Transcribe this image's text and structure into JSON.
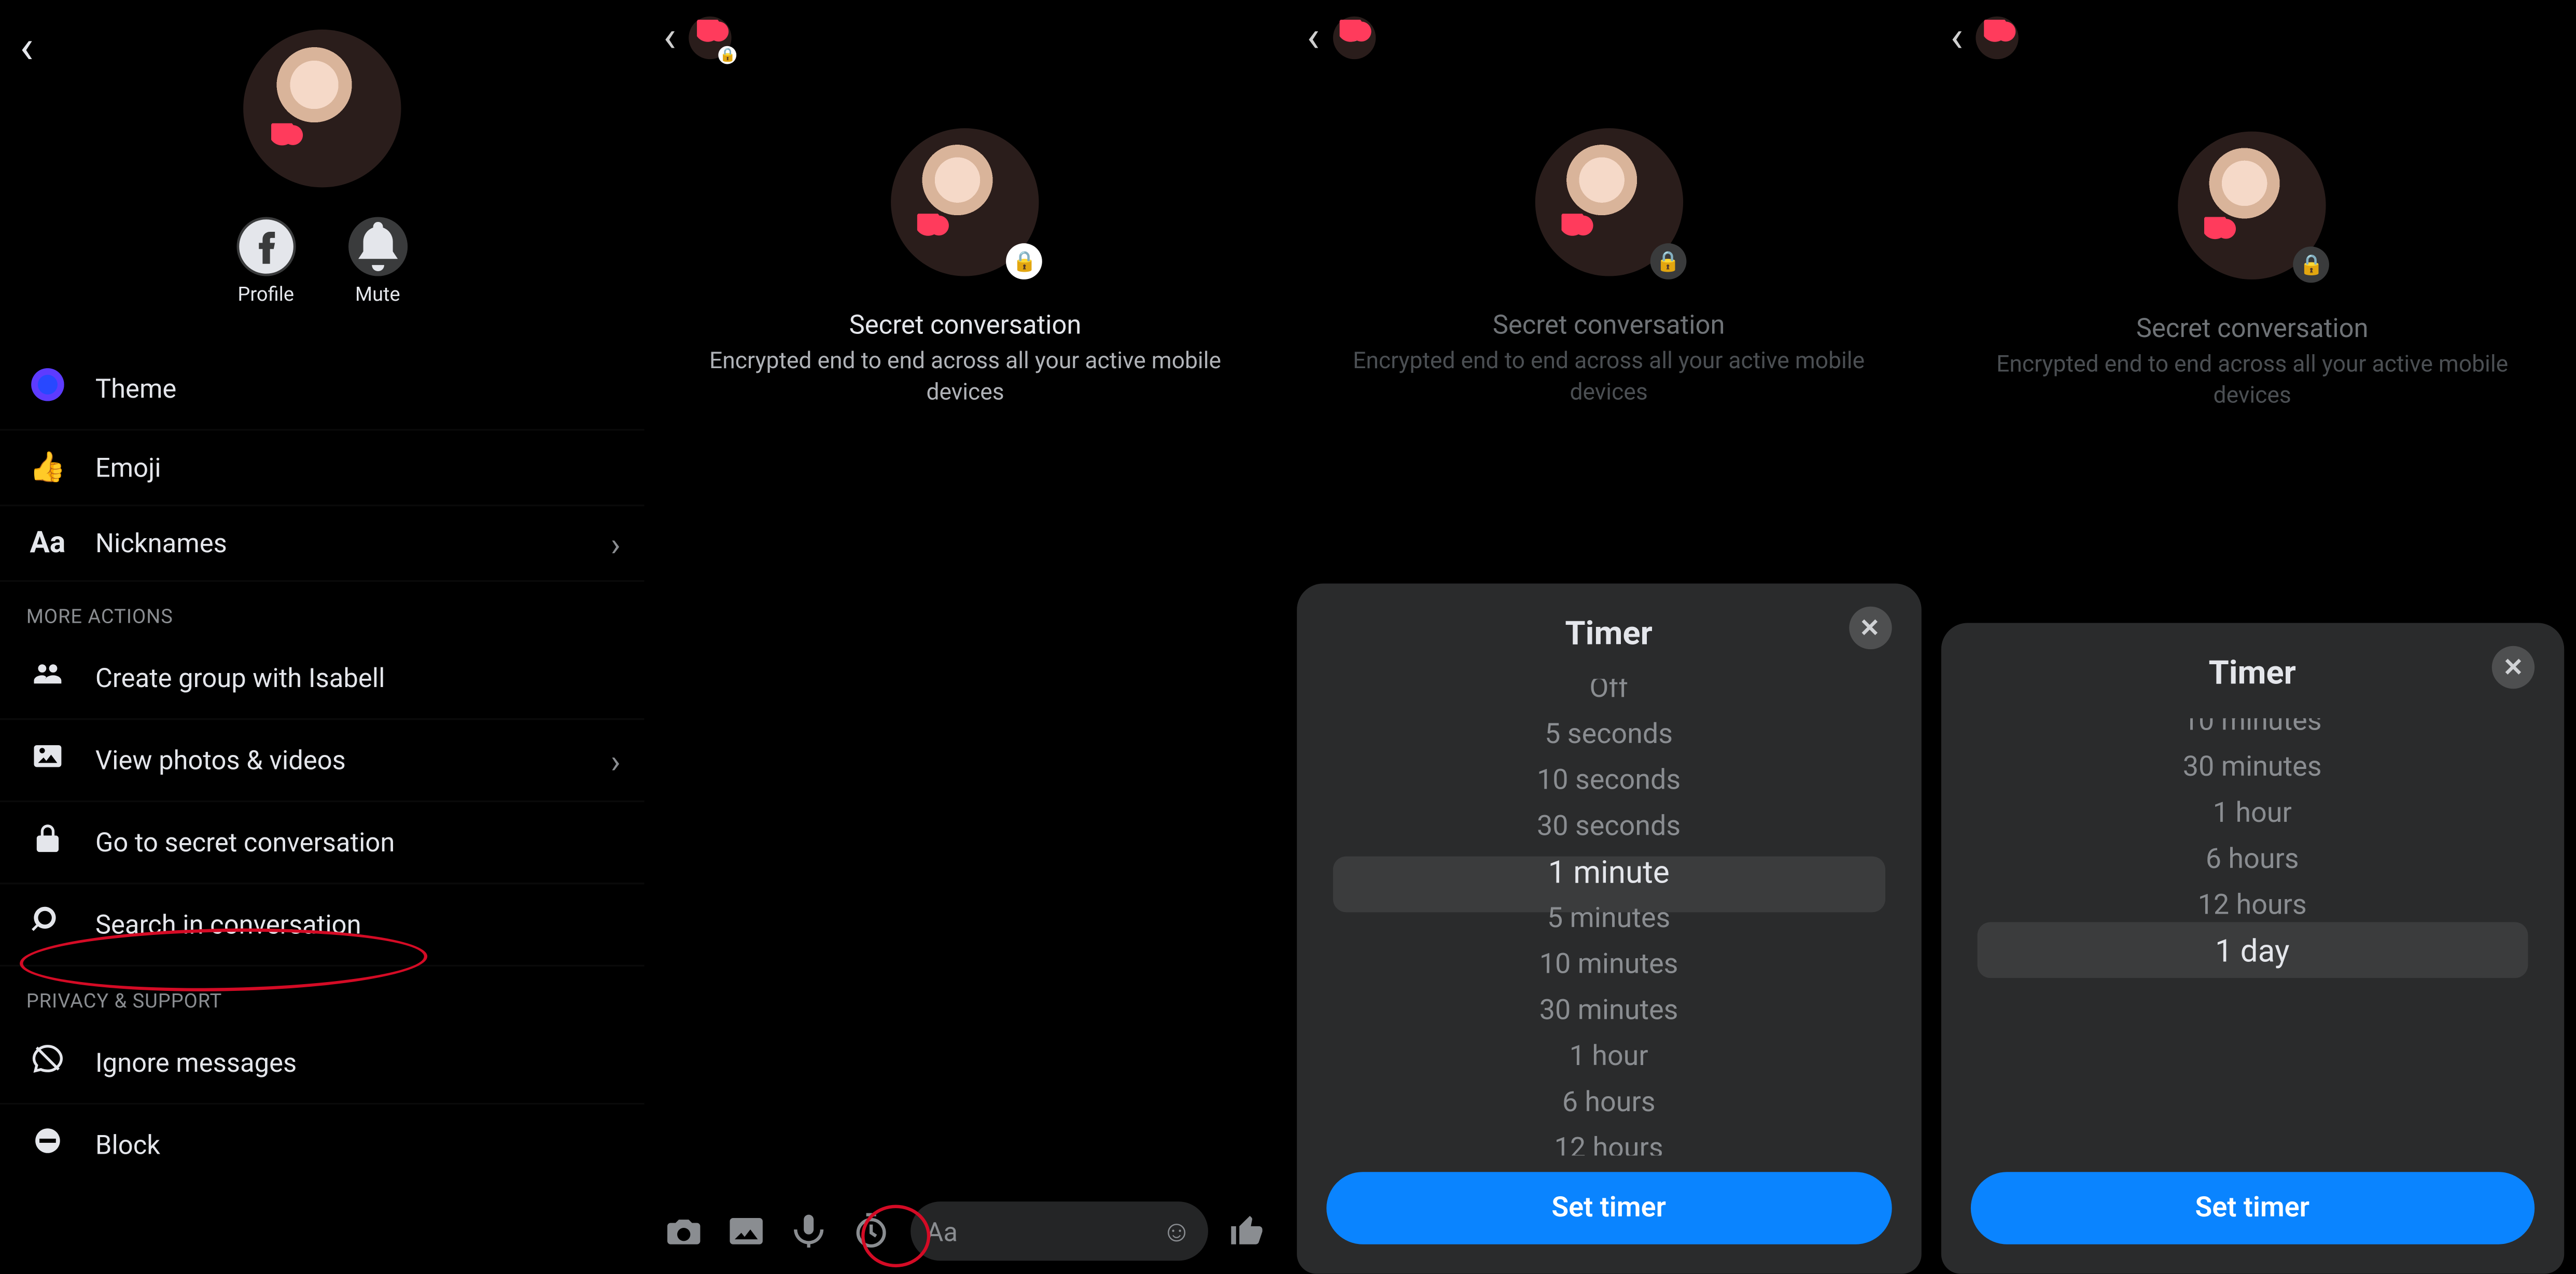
{
  "settings": {
    "actions": {
      "profile": "Profile",
      "mute": "Mute"
    },
    "items": {
      "theme": "Theme",
      "emoji": "Emoji",
      "nick": "Nicknames",
      "group": "Create group with Isabell",
      "photos": "View photos & videos",
      "secret": "Go to secret conversation",
      "search": "Search in conversation",
      "ignore": "Ignore messages",
      "block": "Block"
    },
    "sections": {
      "more": "MORE ACTIONS",
      "privacy": "PRIVACY & SUPPORT"
    }
  },
  "secret": {
    "title": "Secret conversation",
    "subtitle": "Encrypted end to end across all your active mobile devices"
  },
  "composer": {
    "placeholder": "Aa"
  },
  "timer": {
    "title": "Timer",
    "set": "Set timer",
    "options": [
      "Off",
      "5 seconds",
      "10 seconds",
      "30 seconds",
      "1 minute",
      "5 minutes",
      "10 minutes",
      "30 minutes",
      "1 hour",
      "6 hours",
      "12 hours",
      "1 day"
    ],
    "sel_a": "1 minute",
    "sel_b": "1 day"
  }
}
